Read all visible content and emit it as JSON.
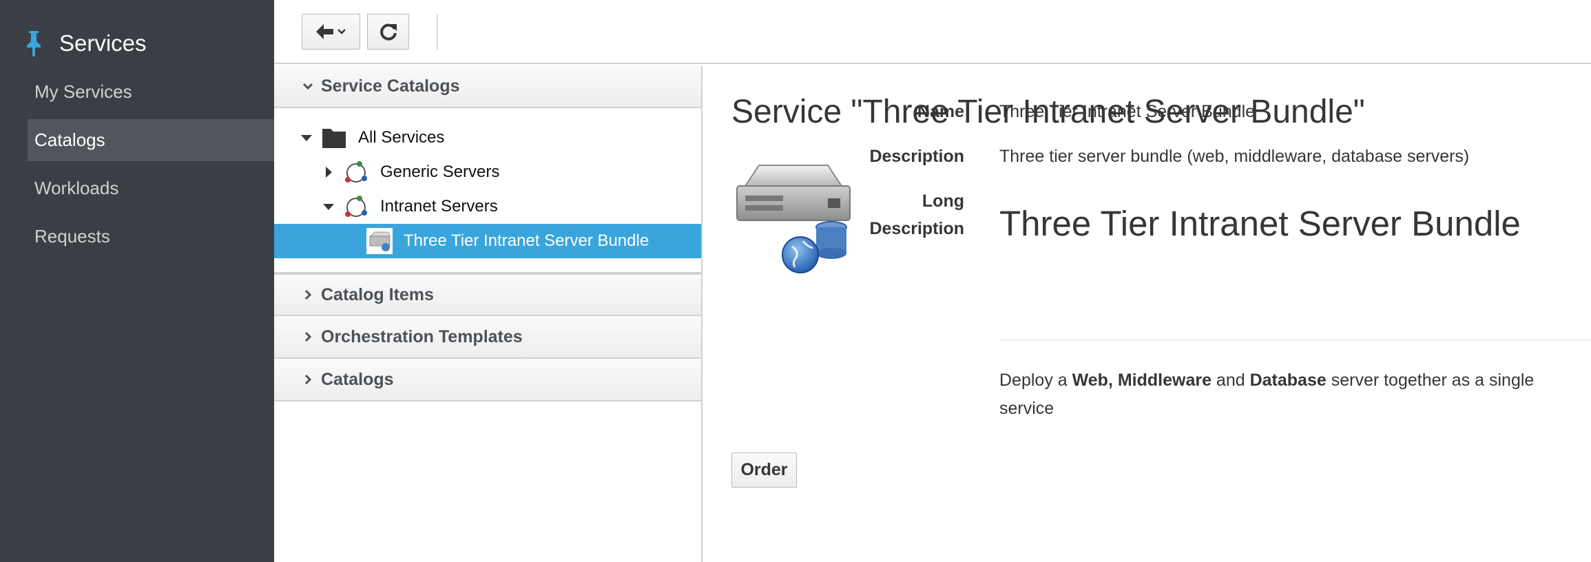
{
  "app": {
    "title": "Services"
  },
  "sidebar": {
    "items": [
      {
        "label": "My Services",
        "active": false
      },
      {
        "label": "Catalogs",
        "active": true
      },
      {
        "label": "Workloads",
        "active": false
      },
      {
        "label": "Requests",
        "active": false
      }
    ]
  },
  "toolbar": {
    "back_icon": "arrow-left-icon",
    "refresh_icon": "refresh-icon"
  },
  "accordion": {
    "service_catalogs": "Service Catalogs",
    "catalog_items": "Catalog Items",
    "orchestration_templates": "Orchestration Templates",
    "catalogs": "Catalogs"
  },
  "tree": {
    "root": "All Services",
    "generic": "Generic Servers",
    "intranet": "Intranet Servers",
    "selected": "Three Tier Intranet Server Bundle"
  },
  "service": {
    "page_title": "Service \"Three Tier Intranet Server Bundle\"",
    "name_label": "Name",
    "name_value": "Three Tier Intranet Server Bundle",
    "description_label": "Description",
    "description_value": "Three tier server bundle (web, middleware, database servers)",
    "long_label_1": "Long",
    "long_label_2": "Description",
    "long_title": "Three Tier Intranet Server Bundle",
    "deploy_prefix": "Deploy a ",
    "deploy_bold_1": "Web, Middleware",
    "deploy_mid": " and ",
    "deploy_bold_2": "Database",
    "deploy_suffix": " server together as a single service",
    "order_label": "Order"
  },
  "colors": {
    "sidebar_bg": "#393f45",
    "selected_row": "#39a5dc",
    "pin": "#39a5dc"
  }
}
